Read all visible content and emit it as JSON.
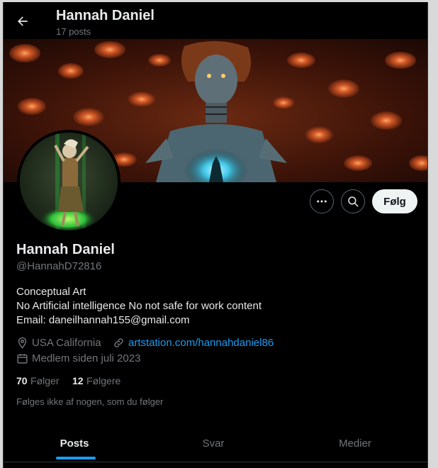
{
  "header": {
    "name": "Hannah Daniel",
    "posts_count": "17 posts"
  },
  "actions": {
    "follow_label": "Følg"
  },
  "profile": {
    "name": "Hannah Daniel",
    "handle": "@HannahD72816",
    "bio": [
      "Conceptual Art",
      "No Artificial intelligence No not safe for work content",
      "Email: daneilhannah155@gmail.com"
    ],
    "location": "USA California",
    "website": "artstation.com/hannahdaniel86",
    "joined": "Medlem siden juli 2023",
    "following_count": "70",
    "following_label": "Følger",
    "followers_count": "12",
    "followers_label": "Følgere",
    "followed_by_note": "Følges ikke af nogen, som du følger"
  },
  "tabs": [
    {
      "label": "Posts",
      "active": true
    },
    {
      "label": "Svar",
      "active": false
    },
    {
      "label": "Medier",
      "active": false
    }
  ],
  "colors": {
    "accent": "#1d9bf0",
    "background": "#000000",
    "muted": "#71767b",
    "text": "#e7e9ea"
  },
  "icons": [
    "back-arrow-icon",
    "more-icon",
    "search-icon",
    "location-icon",
    "link-icon",
    "calendar-icon"
  ]
}
